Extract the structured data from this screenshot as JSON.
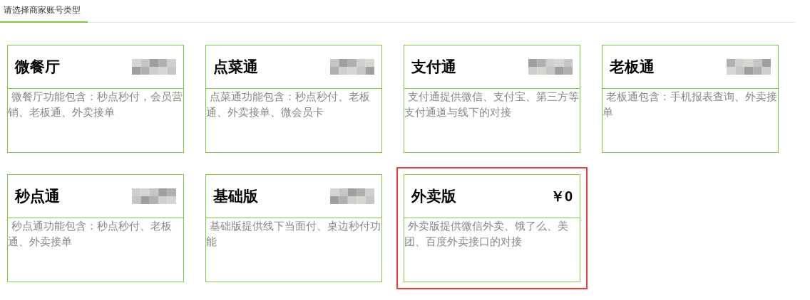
{
  "tab": {
    "label": "请选择商家账号类型",
    "selected": true
  },
  "cards": [
    {
      "title": "微餐厅",
      "price_blurred": true,
      "description": "微餐厅功能包含：秒点秒付，会员营销、老板通、外卖接单",
      "selected": false
    },
    {
      "title": "点菜通",
      "price_blurred": true,
      "description": "点菜通功能包含：秒点秒付、老板通、外卖接单、微会员卡",
      "selected": false
    },
    {
      "title": "支付通",
      "price_blurred": true,
      "description": "支付通提供微信、支付宝、第三方等支付通道与线下的对接",
      "selected": false
    },
    {
      "title": "老板通",
      "price_blurred": true,
      "description": "老板通包含：手机报表查询、外卖接单",
      "selected": false
    },
    {
      "title": "秒点通",
      "price_blurred": true,
      "description": "秒点通功能包含：秒点秒付、老板通、外卖接单",
      "selected": false
    },
    {
      "title": "基础版",
      "price_blurred": true,
      "description": "基础版提供线下当面付、桌边秒付功能",
      "selected": false
    },
    {
      "title": "外卖版",
      "price": "￥0",
      "description": "外卖版提供微信外卖、饿了么、美团、百度外卖接口的对接",
      "selected": true
    }
  ]
}
